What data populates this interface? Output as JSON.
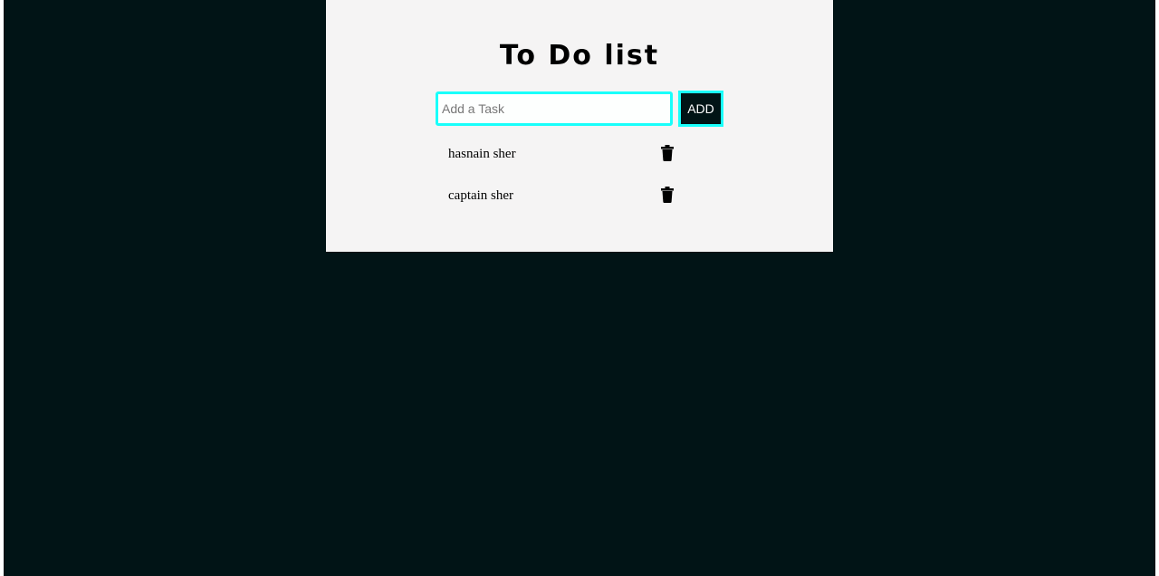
{
  "app": {
    "title": "To Do list"
  },
  "input": {
    "placeholder": "Add a Task",
    "value": ""
  },
  "buttons": {
    "add_label": "ADD"
  },
  "tasks": [
    {
      "text": "hasnain sher",
      "delete_icon": "trash-icon"
    },
    {
      "text": "captain sher",
      "delete_icon": "trash-icon"
    }
  ],
  "colors": {
    "page_background": "#011416",
    "card_background": "#f5f4f4",
    "accent_border": "#19fffb",
    "button_background": "#011416",
    "button_text": "#ffffff"
  }
}
